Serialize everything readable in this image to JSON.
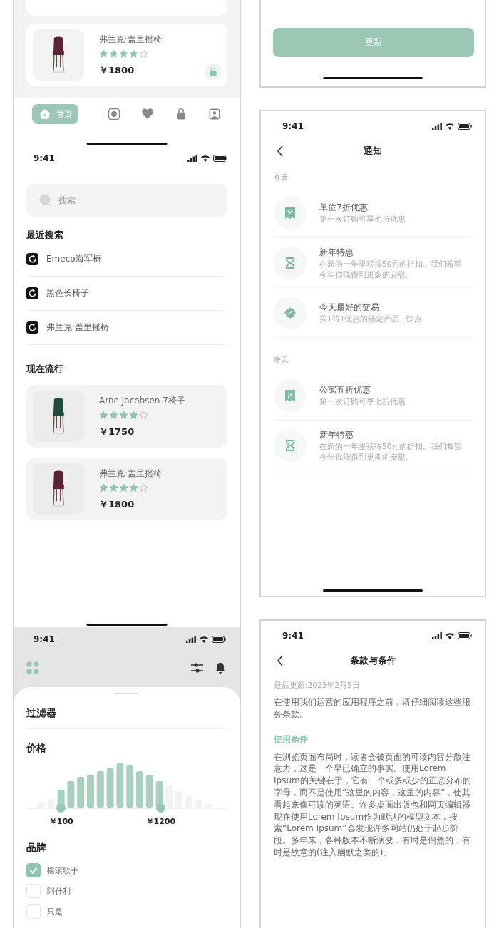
{
  "left_column": {
    "product_screen": {
      "products": [
        {
          "name": "弗兰克·盖里摇椅",
          "stars": 4,
          "price": "￥1800",
          "color": "#5a2436"
        }
      ],
      "tab_bar": [
        {
          "kind": "home",
          "label": "首页",
          "selected": true
        },
        {
          "kind": "box",
          "selected": false
        },
        {
          "kind": "heart",
          "selected": false
        },
        {
          "kind": "bag",
          "selected": false
        },
        {
          "kind": "profile",
          "selected": false
        }
      ]
    },
    "search_screen": {
      "status_time": "9:41",
      "search": {
        "placeholder": "搜索"
      },
      "recent_title": "最近搜索",
      "recent": [
        "Emeco海军椅",
        "黑色长椅子",
        "弗兰克·盖里摇椅"
      ],
      "trending_title": "现在流行",
      "products": [
        {
          "name": "Arne Jacobsen 7椅子",
          "stars": 4,
          "price": "￥1750",
          "color": "#1f4a3e"
        },
        {
          "name": "弗兰克·盖里摇椅",
          "stars": 4,
          "price": "￥1800",
          "color": "#5a2436"
        }
      ]
    },
    "filter_screen": {
      "status_time": "9:41",
      "title": "过滤器",
      "price_title": "价格",
      "price_thumbs": [
        {
          "level": 0.173,
          "label": "￥100"
        },
        {
          "level": 0.668,
          "label": "￥1200"
        }
      ],
      "brand_title": "品牌",
      "brands": [
        {
          "label": "摇滚歌手",
          "checked": true
        },
        {
          "label": "阿什利",
          "checked": false
        },
        {
          "label": "只是",
          "checked": false
        }
      ]
    }
  },
  "right_column": {
    "update_screen": {
      "button": "更新"
    },
    "notifications_screen": {
      "status_time": "9:41",
      "title": "通知",
      "groups": [
        {
          "label": "今天",
          "items": [
            {
              "kind": "coupon",
              "title": "单位7折优惠",
              "text": "第一次订购可享七折优惠"
            },
            {
              "kind": "hourglass",
              "title": "新年特惠",
              "text": "在新的一年里获得50元的折扣。我们希望今年你能得到更多的安慰。"
            },
            {
              "kind": "badge",
              "title": "今天最好的交易",
              "text": "买1得1优惠的选定产品...快点"
            }
          ]
        },
        {
          "label": "昨天",
          "items": [
            {
              "kind": "coupon",
              "title": "公寓五折优惠",
              "text": "第一次订购可享七折优惠"
            },
            {
              "kind": "hourglass",
              "title": "新年特惠",
              "text": "在新的一年里获得50元的折扣。我们希望今年你能得到更多的安慰。"
            }
          ]
        }
      ]
    },
    "terms_screen": {
      "status_time": "9:41",
      "title": "条款与条件",
      "updated": "最后更新:2023年2月5日",
      "intro": "在使用我们运营的应用程序之前，请仔细阅读这些服务条款。",
      "heading": "使用条件",
      "body": "在浏览页面布局时，读者会被页面的可读内容分散注意力，这是一个早已确立的事实。使用Lorem Ipsum的关键在于，它有一个或多或少的正态分布的字母，而不是使用“这里的内容，这里的内容”，使其看起来像可读的英语。许多桌面出版包和网页编辑器现在使用Lorem Ipsum作为默认的模型文本，搜索“Lorem Ipsum”会发现许多网站仍处于起步阶段。多年来，各种版本不断演变，有时是偶然的，有时是故意的(注入幽默之类的)。"
    }
  }
}
